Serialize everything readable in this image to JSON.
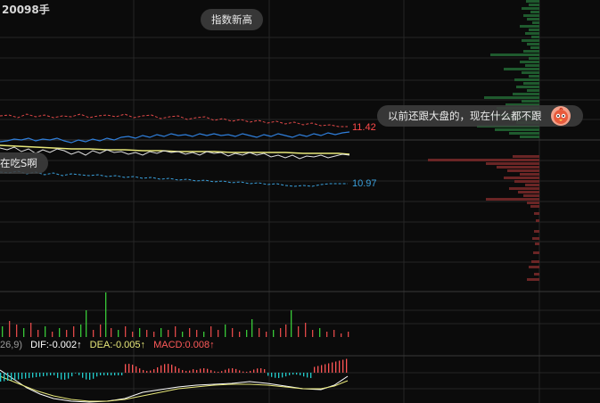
{
  "volume": {
    "label": "20098手"
  },
  "bubbles": {
    "top_center": "指数新高",
    "right_comment": "以前还跟大盘的，现在什么都不跟",
    "left_comment": "在吃S啊"
  },
  "price_levels": {
    "upper": "11.42",
    "lower": "10.97"
  },
  "indicator": {
    "params_suffix": "26,9)",
    "dif": "DIF:-0.002↑",
    "dea": "DEA:-0.005↑",
    "macd": "MACD:0.008↑"
  },
  "colors": {
    "background": "#0b0b0b",
    "grid": "#2a2a2a",
    "upper_line": "#e04848",
    "lower_line": "#3aa0dc",
    "price_line": "#2f7fdc",
    "avg_line": "#e8e87a",
    "macd_up": "#ff5555",
    "macd_down": "#22cccc",
    "vol_profile_up": "#1f5a2e",
    "vol_profile_down": "#6a2525",
    "volume_bar_green": "#38c838",
    "volume_bar_red": "#e04848"
  },
  "icons": {
    "avatar": "bird-avatar-icon"
  }
}
